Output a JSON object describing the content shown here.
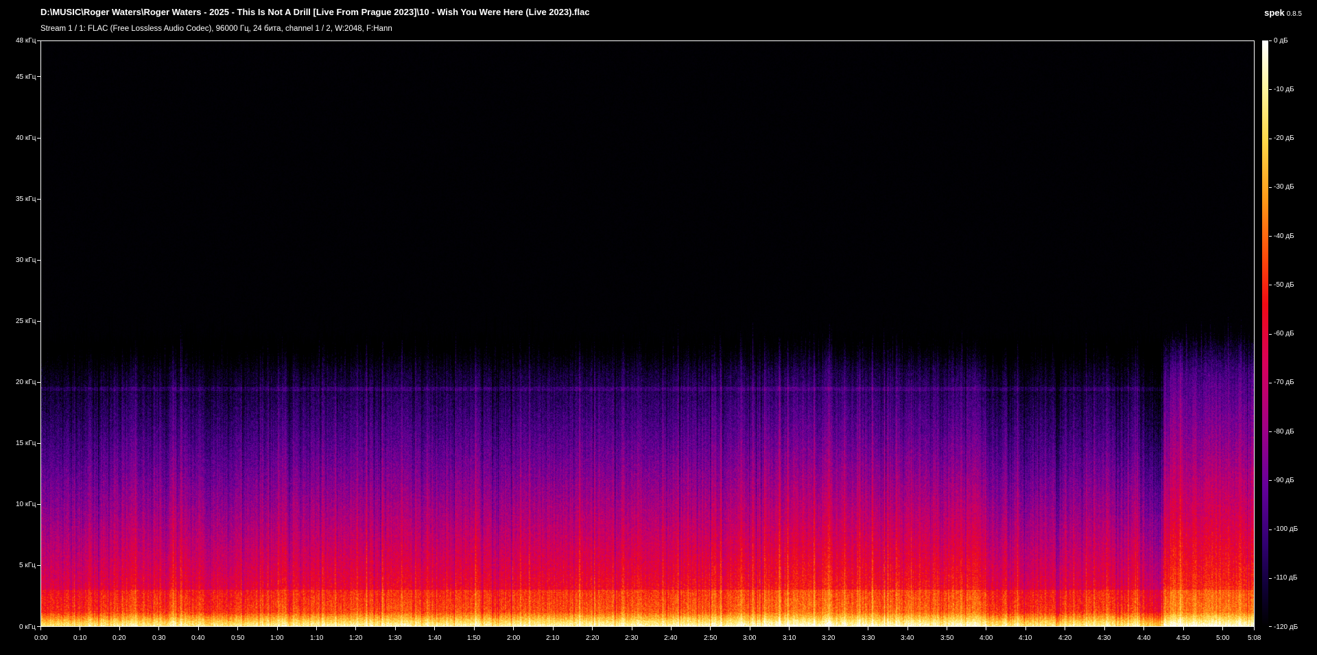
{
  "window": {
    "title": "D:\\MUSIC\\Roger Waters\\Roger Waters - 2025 - This Is Not A Drill [Live From Prague 2023]\\10 - Wish You Were Here (Live 2023).flac",
    "stream_info": "Stream 1 / 1: FLAC (Free Lossless Audio Codec), 96000 Гц, 24 бита, channel 1 / 2, W:2048, F:Hann",
    "app_name": "spek",
    "app_version": "0.8.5"
  },
  "frequency_axis": {
    "max_khz": 48,
    "ticks": [
      {
        "value": 48,
        "label": "48 кГц"
      },
      {
        "value": 45,
        "label": "45 кГц"
      },
      {
        "value": 40,
        "label": "40 кГц"
      },
      {
        "value": 35,
        "label": "35 кГц"
      },
      {
        "value": 30,
        "label": "30 кГц"
      },
      {
        "value": 25,
        "label": "25 кГц"
      },
      {
        "value": 20,
        "label": "20 кГц"
      },
      {
        "value": 15,
        "label": "15 кГц"
      },
      {
        "value": 10,
        "label": "10 кГц"
      },
      {
        "value": 5,
        "label": "5 кГц"
      },
      {
        "value": 0,
        "label": "0 кГц"
      }
    ]
  },
  "time_axis": {
    "duration_seconds": 308,
    "labels": [
      "0:00",
      "0:10",
      "0:20",
      "0:30",
      "0:40",
      "0:50",
      "1:00",
      "1:10",
      "1:20",
      "1:30",
      "1:40",
      "1:50",
      "2:00",
      "2:10",
      "2:20",
      "2:30",
      "2:40",
      "2:50",
      "3:00",
      "3:10",
      "3:20",
      "3:30",
      "3:40",
      "3:50",
      "4:00",
      "4:10",
      "4:20",
      "4:30",
      "4:40",
      "4:50",
      "5:00",
      "5:08"
    ]
  },
  "db_scale": {
    "min_db": -120,
    "max_db": 0,
    "labels": [
      "0 дБ",
      "-10 дБ",
      "-20 дБ",
      "-30 дБ",
      "-40 дБ",
      "-50 дБ",
      "-60 дБ",
      "-70 дБ",
      "-80 дБ",
      "-90 дБ",
      "-100 дБ",
      "-110 дБ",
      "-120 дБ"
    ]
  },
  "spectrogram": {
    "cutoff_khz": 24,
    "bright_band_khz": 19.5,
    "quiet_section_start_seconds": 285
  }
}
